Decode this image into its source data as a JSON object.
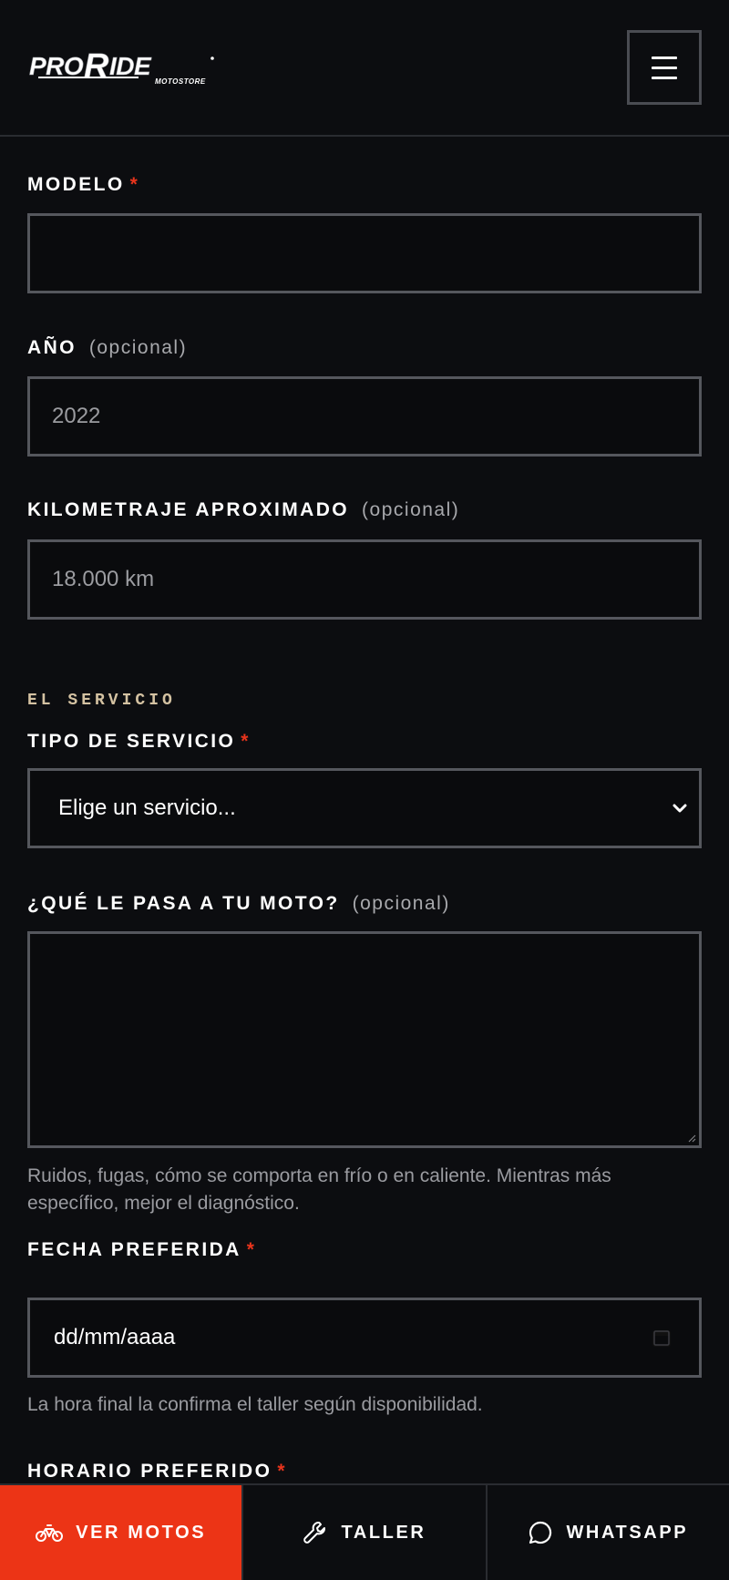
{
  "header": {
    "logo_text": "PROR IDE",
    "logo_sub": "MOTOSTORE"
  },
  "form": {
    "modelo": {
      "label": "MODELO",
      "required_mark": "*",
      "value": ""
    },
    "anio": {
      "label": "AÑO",
      "optional": "(opcional)",
      "placeholder": "2022"
    },
    "kilometraje": {
      "label": "KILOMETRAJE APROXIMADO",
      "optional": "(opcional)",
      "placeholder": "18.000 km"
    },
    "section_service": "EL SERVICIO",
    "tipo_servicio": {
      "label": "TIPO DE SERVICIO",
      "required_mark": "*",
      "selected": "Elige un servicio..."
    },
    "que_pasa": {
      "label": "¿QUÉ LE PASA A TU MOTO?",
      "optional": "(opcional)",
      "help": "Ruidos, fugas, cómo se comporta en frío o en caliente. Mientras más específico, mejor el diagnóstico."
    },
    "fecha": {
      "label": "FECHA PREFERIDA",
      "required_mark": "*",
      "value": "dd/mm/aaaa",
      "help": "La hora final la confirma el taller según disponibilidad."
    },
    "horario": {
      "label": "HORARIO PREFERIDO",
      "required_mark": "*"
    }
  },
  "bottom_nav": {
    "items": [
      {
        "label": "VER MOTOS",
        "icon": "bicycle-icon"
      },
      {
        "label": "TALLER",
        "icon": "wrench-icon"
      },
      {
        "label": "WHATSAPP",
        "icon": "chat-bubble-icon"
      }
    ],
    "active_color": "#ec3416"
  }
}
